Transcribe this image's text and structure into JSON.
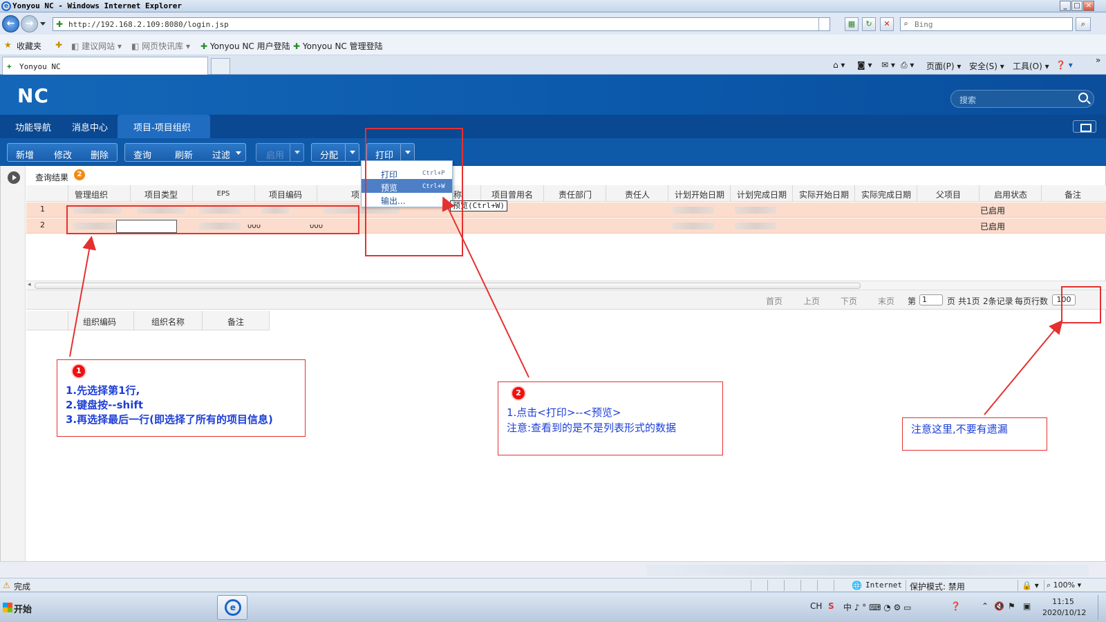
{
  "browser": {
    "title": "Yonyou NC - Windows Internet Explorer",
    "url": "http://192.168.2.109:8080/login.jsp",
    "search_placeholder": "Bing",
    "favorites": [
      "收藏夹",
      "建议网站",
      "网页快讯库",
      "Yonyou NC 用户登陆",
      "Yonyou NC 管理登陆"
    ],
    "tab_title": "Yonyou NC",
    "commands": [
      "页面(P)",
      "安全(S)",
      "工具(O)"
    ]
  },
  "app": {
    "logo": "NC",
    "search_placeholder": "搜索",
    "nav_tabs": [
      "功能导航",
      "消息中心",
      "项目-项目组织"
    ],
    "toolbar": {
      "group1": [
        "新增",
        "修改",
        "删除"
      ],
      "group2": [
        "查询",
        "刷新",
        "过滤"
      ],
      "enable": "启用",
      "assign": "分配",
      "print": "打印"
    },
    "print_menu": [
      {
        "label": "打印",
        "shortcut": "Ctrl+P"
      },
      {
        "label": "预览",
        "shortcut": "Ctrl+W"
      },
      {
        "label": "输出..."
      }
    ],
    "tooltip": "预览(Ctrl+W)",
    "result_title": "查询结果",
    "result_count": "2",
    "columns": [
      "管理组织",
      "项目类型",
      "EPS",
      "项目编码",
      "项目",
      "称",
      "项目曾用名",
      "责任部门",
      "责任人",
      "计划开始日期",
      "计划完成日期",
      "实际开始日期",
      "实际完成日期",
      "父项目",
      "启用状态",
      "备注"
    ],
    "rows": [
      {
        "no": "1",
        "status": "已启用"
      },
      {
        "no": "2",
        "status": "已启用",
        "code": "000",
        "name": "000"
      }
    ],
    "pager": {
      "first": "首页",
      "prev": "上页",
      "next": "下页",
      "last": "末页",
      "page_prefix": "第",
      "page_value": "1",
      "page_suffix": "页",
      "total_pages": "共1页",
      "records": "2条记录",
      "per_page_label": "每页行数",
      "per_page_value": "100"
    },
    "sub_columns": [
      "组织编码",
      "组织名称",
      "备注"
    ]
  },
  "annotations": {
    "a1": {
      "num": "1",
      "lines": [
        "1.先选择第1行,",
        "2.键盘按--shift",
        "3.再选择最后一行(即选择了所有的项目信息)"
      ]
    },
    "a2": {
      "num": "2",
      "lines": [
        "1.点击<打印>--<预览>",
        "注意:查看到的是不是列表形式的数据"
      ]
    },
    "a3": {
      "lines": [
        "注意这里,不要有遗漏"
      ]
    },
    "color": "#e53030"
  },
  "status": {
    "text": "完成",
    "zone": "Internet",
    "protected_mode": "保护模式: 禁用",
    "zoom": "100%"
  },
  "taskbar": {
    "start": "开始",
    "lang": "CH",
    "time": "11:15",
    "date": "2020/10/12"
  }
}
